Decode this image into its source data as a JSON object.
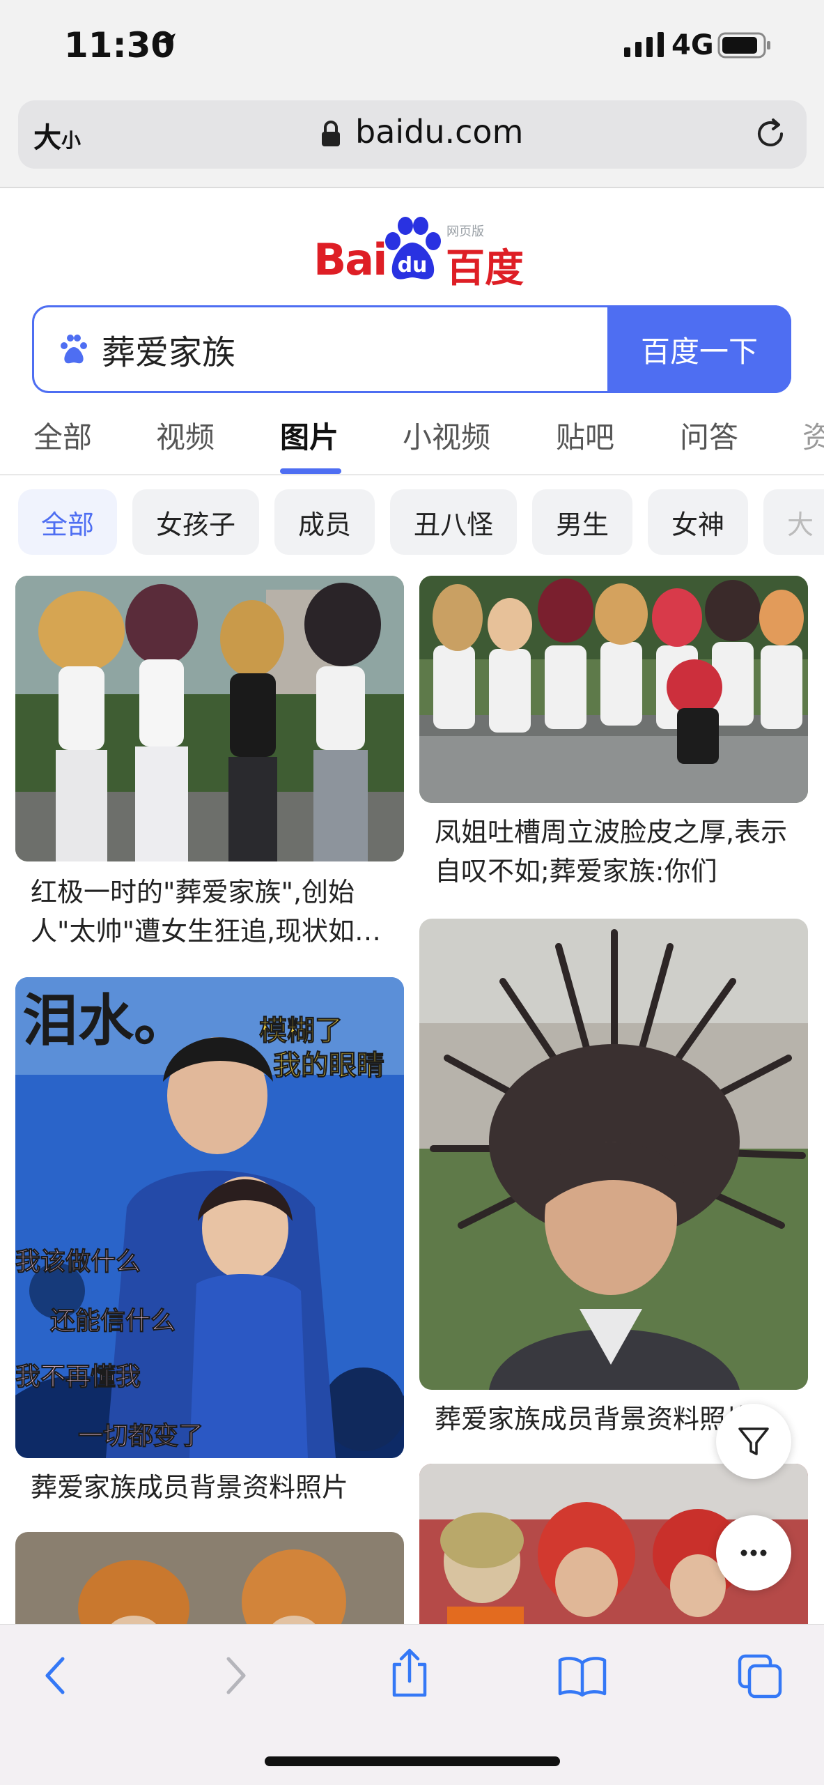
{
  "status_bar": {
    "time": "11:30",
    "network": "4G"
  },
  "browser": {
    "text_size_label_big": "大",
    "text_size_label_small": "小",
    "domain": "baidu.com"
  },
  "logo": {
    "left": "Bai",
    "right": "百度",
    "paw_text": "du",
    "web_label": "网页版"
  },
  "search": {
    "query": "葬爱家族",
    "button_label": "百度一下"
  },
  "tabs": [
    {
      "label": "全部",
      "active": false
    },
    {
      "label": "视频",
      "active": false
    },
    {
      "label": "图片",
      "active": true
    },
    {
      "label": "小视频",
      "active": false
    },
    {
      "label": "贴吧",
      "active": false
    },
    {
      "label": "问答",
      "active": false
    },
    {
      "label": "资",
      "active": false
    }
  ],
  "filters": [
    {
      "label": "全部",
      "active": true
    },
    {
      "label": "女孩子",
      "active": false
    },
    {
      "label": "成员",
      "active": false
    },
    {
      "label": "丑八怪",
      "active": false
    },
    {
      "label": "男生",
      "active": false
    },
    {
      "label": "女神",
      "active": false
    },
    {
      "label": "大",
      "active": false
    }
  ],
  "results": {
    "left": [
      {
        "caption": "红极一时的\"葬爱家族\",创始人\"太帅\"遭女生狂追,现状如…"
      },
      {
        "caption": "葬爱家族成员背景资料照片",
        "overlay_text": [
          "泪水。",
          "模糊了",
          "我的眼睛",
          "我该做什么",
          "还能信什么",
          "我不再懂我",
          "一切都变了"
        ]
      },
      {
        "caption": ""
      }
    ],
    "right": [
      {
        "caption": "凤姐吐槽周立波脸皮之厚,表示自叹不如;葬爱家族:你们"
      },
      {
        "caption": "葬爱家族成员背景资料照片"
      },
      {
        "caption": ""
      }
    ]
  },
  "colors": {
    "accent": "#4e6ef2",
    "brand_red": "#de1e25"
  },
  "icons": {
    "filter": "filter-icon",
    "more": "more-icon",
    "back": "back-arrow-icon",
    "forward": "forward-arrow-icon",
    "share": "share-icon",
    "bookmarks": "bookmarks-icon",
    "tabs": "tabs-icon"
  }
}
